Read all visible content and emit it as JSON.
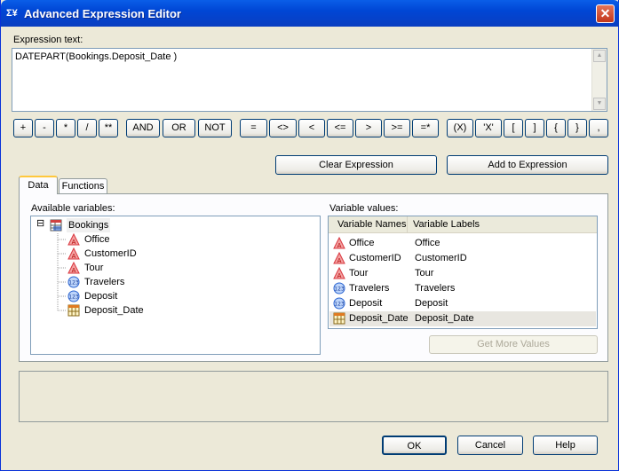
{
  "window": {
    "title": "Advanced Expression Editor",
    "title_icon": "Σ¥",
    "close": "✕"
  },
  "expression": {
    "label": "Expression text:",
    "value": "DATEPART(Bookings.Deposit_Date )"
  },
  "operators": [
    "+",
    "-",
    "*",
    "/",
    "**",
    "AND",
    "OR",
    "NOT",
    "=",
    "<>",
    "<",
    "<=",
    ">",
    ">=",
    "=*",
    "(X)",
    "'X'",
    "[",
    "]",
    "{",
    "}",
    ","
  ],
  "actions": {
    "clear": "Clear Expression",
    "add": "Add to Expression"
  },
  "tabs": [
    {
      "label": "Data",
      "active": true
    },
    {
      "label": "Functions",
      "active": false
    }
  ],
  "available": {
    "label": "Available variables:",
    "root": "Bookings",
    "expander": "⊟",
    "items": [
      {
        "name": "Office",
        "icon": "character-variable-icon"
      },
      {
        "name": "CustomerID",
        "icon": "character-variable-icon"
      },
      {
        "name": "Tour",
        "icon": "character-variable-icon"
      },
      {
        "name": "Travelers",
        "icon": "numeric-variable-icon"
      },
      {
        "name": "Deposit",
        "icon": "numeric-variable-icon"
      },
      {
        "name": "Deposit_Date",
        "icon": "date-variable-icon"
      }
    ]
  },
  "values": {
    "label": "Variable values:",
    "columns": [
      "Variable Names",
      "Variable Labels"
    ],
    "rows": [
      {
        "name": "Office",
        "label": "Office",
        "icon": "character-variable-icon"
      },
      {
        "name": "CustomerID",
        "label": "CustomerID",
        "icon": "character-variable-icon"
      },
      {
        "name": "Tour",
        "label": "Tour",
        "icon": "character-variable-icon"
      },
      {
        "name": "Travelers",
        "label": "Travelers",
        "icon": "numeric-variable-icon"
      },
      {
        "name": "Deposit",
        "label": "Deposit",
        "icon": "numeric-variable-icon"
      },
      {
        "name": "Deposit_Date",
        "label": "Deposit_Date",
        "icon": "date-variable-icon",
        "selected": true
      }
    ],
    "more_button": "Get More Values"
  },
  "footer": {
    "ok": "OK",
    "cancel": "Cancel",
    "help": "Help"
  },
  "colors": {
    "titlebar": "#0a5ee8",
    "dialog_bg": "#ece9d8",
    "character_icon": "#d9363e",
    "numeric_icon": "#2a64d1",
    "tab_highlight": "#ffc83c"
  }
}
